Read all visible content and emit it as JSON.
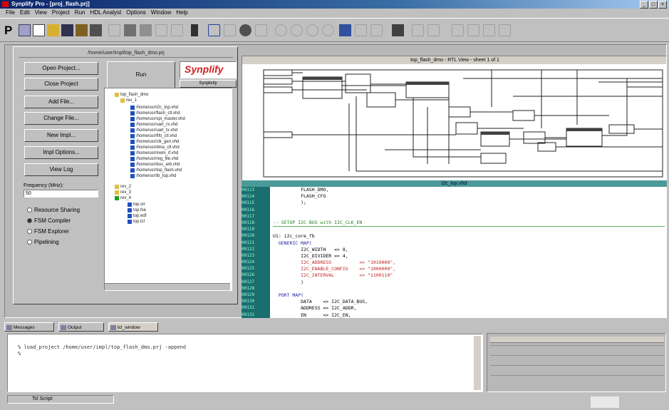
{
  "window": {
    "title": "Synplify Pro - [proj_flash.prj]"
  },
  "menu": [
    "File",
    "Edit",
    "View",
    "Project",
    "Run",
    "HDL Analyst",
    "Options",
    "Window",
    "Help"
  ],
  "toolbar": {
    "logo_letter": "P"
  },
  "project_panel": {
    "title": "/home/user/impl/top_flash_dmo.prj",
    "buttons": [
      "Open Project...",
      "Close Project",
      "Add File...",
      "Change File...",
      "New Impl...",
      "Impl Options...",
      "View Log"
    ],
    "run_label": "Run",
    "brand": "Synplify",
    "brand_sub": "Synplicity",
    "frequency_label": "Frequency (MHz):",
    "frequency_value": "50",
    "options": [
      {
        "label": "Resource Sharing",
        "checked": false
      },
      {
        "label": "FSM Compiler",
        "checked": true
      },
      {
        "label": "FSM Explorer",
        "checked": false
      },
      {
        "label": "Pipelining",
        "checked": false
      }
    ],
    "tree": [
      "top_flash_dmo",
      "rev_1",
      "/home/usr/i2c_top.vhd",
      "/home/usr/flash_ctl.vhd",
      "/home/usr/spi_master.vhd",
      "/home/usr/uart_rx.vhd",
      "/home/usr/uart_tx.vhd",
      "/home/usr/fifo_ctl.vhd",
      "/home/usr/clk_gen.vhd",
      "/home/usr/dma_ctl.vhd",
      "/home/usr/mem_if.vhd",
      "/home/usr/reg_file.vhd",
      "/home/usr/bus_arb.vhd",
      "/home/usr/top_flash.vhd",
      "/home/usr/tb_top.vhd",
      "rev_2",
      "rev_3",
      "rev_4",
      "top.srr",
      "top.fse",
      "top.edf",
      "top.tcl"
    ]
  },
  "schematic": {
    "title": "top_flash_dmo - RTL View - sheet 1 of 1"
  },
  "editor": {
    "title": "i2c_top.vhd",
    "line_numbers": [
      "00113",
      "00114",
      "00115",
      "00116",
      "00117",
      "00118",
      "00119",
      "00120",
      "00121",
      "00122",
      "00123",
      "00124",
      "00125",
      "00126",
      "00127",
      "00128",
      "00129",
      "00130",
      "00131",
      "00132"
    ],
    "lines": [
      "          FLASH_DMO,",
      "          FLASH_CFG",
      "          );",
      "",
      "",
      "-- SETUP I2C BUS with I2C_CLK_EN",
      "",
      "U1: i2c_core_fb",
      "  GENERIC MAP(",
      "          I2C_WIDTH   => 8,",
      "          I2C_DIVIDER => 4,",
      "          I2C_ADDRESS          => \"1010000\",",
      "          I2C_ENABLE_CONFIG    => \"1000000\",",
      "          I2C_INTERVAL         => \"1100110\"",
      "          )",
      "",
      "  PORT MAP(",
      "          DATA    => I2C_DATA_BUS,",
      "          ADDRESS => I2C_ADDR,",
      "          EN      => I2C_EN,"
    ]
  },
  "bottom_tabs": [
    "Messages",
    "Output",
    "tcl_window"
  ],
  "tcl": {
    "line1": "% load_project /home/user/impl/top_flash_dmo.prj -append",
    "line2": "%"
  },
  "statusbar": {
    "text": "Tcl Script"
  }
}
